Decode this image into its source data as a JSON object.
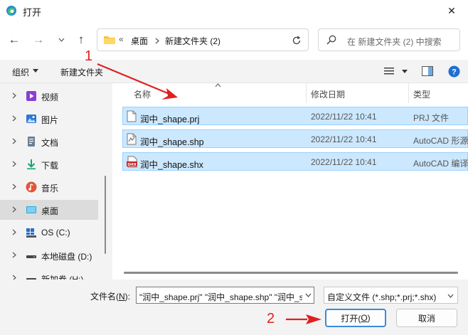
{
  "window": {
    "title": "打开",
    "close_glyph": "✕"
  },
  "nav": {
    "back_glyph": "←",
    "forward_glyph": "→",
    "recent_glyph": "⌄",
    "up_glyph": "↑"
  },
  "address": {
    "separator": "«",
    "crumbs": [
      "桌面",
      "新建文件夹 (2)"
    ]
  },
  "search": {
    "placeholder": "在 新建文件夹 (2) 中搜索"
  },
  "toolbar": {
    "organize": "组织",
    "new_folder": "新建文件夹"
  },
  "sidebar": {
    "items": [
      {
        "label": "视频",
        "icon": "video-icon"
      },
      {
        "label": "图片",
        "icon": "pictures-icon"
      },
      {
        "label": "文档",
        "icon": "documents-icon"
      },
      {
        "label": "下载",
        "icon": "downloads-icon"
      },
      {
        "label": "音乐",
        "icon": "music-icon"
      },
      {
        "label": "桌面",
        "icon": "desktop-icon",
        "selected": true
      },
      {
        "label": "OS (C:)",
        "icon": "windows-drive-icon"
      },
      {
        "label": "本地磁盘 (D:)",
        "icon": "drive-icon"
      },
      {
        "label": "新加卷 (H:)",
        "icon": "drive-icon"
      }
    ]
  },
  "columns": {
    "name": "名称",
    "modified": "修改日期",
    "type": "类型"
  },
  "files": [
    {
      "name": "润中_shape.prj",
      "modified": "2022/11/22 10:41",
      "type": "PRJ 文件",
      "icon": "text-file-icon"
    },
    {
      "name": "润中_shape.shp",
      "modified": "2022/11/22 10:41",
      "type": "AutoCAD 形源",
      "icon": "shp-file-icon"
    },
    {
      "name": "润中_shape.shx",
      "modified": "2022/11/22 10:41",
      "type": "AutoCAD 编译",
      "icon": "shx-file-icon"
    }
  ],
  "bottom": {
    "filename_label": "文件名(",
    "filename_key": "N",
    "filename_label_end": "):",
    "filename_value": "\"润中_shape.prj\" \"润中_shape.shp\" \"润中_shape.shx\"",
    "filetype": "自定义文件 (*.shp;*.prj;*.shx)",
    "open_label": "打开(",
    "open_key": "O",
    "open_label_end": ")",
    "cancel": "取消"
  },
  "annotations": {
    "step1": "1",
    "step2": "2",
    "color": "#e02020"
  },
  "colors": {
    "selection_bg": "#cce8ff",
    "selection_border": "#99d1ff",
    "accent": "#3b8bd8"
  }
}
